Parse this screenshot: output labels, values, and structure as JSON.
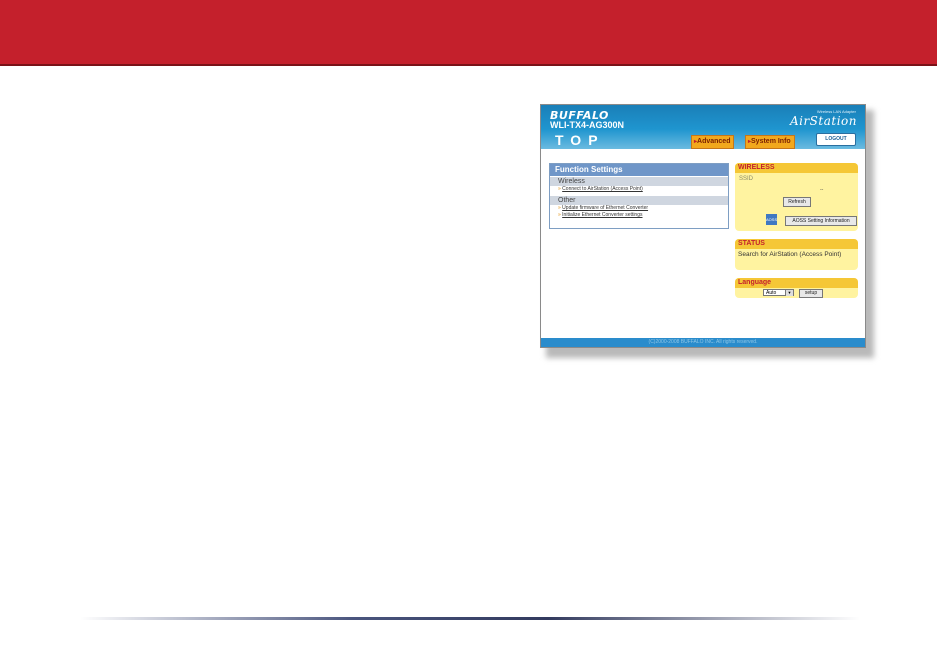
{
  "colors": {
    "banner": "#c4202c",
    "header_blue": "#1f95cf",
    "tab_orange": "#f2a81d",
    "box_yellow": "#fff3a0",
    "section_blue": "#6f96c8"
  },
  "header": {
    "brand": "BUFFALO",
    "model": "WLI-TX4-AG300N",
    "tagline": "Wireless LAN Adapter",
    "product_logo": "AirStation",
    "page_label": "TOP",
    "tab_advanced": "Advanced",
    "tab_system_info": "System Info",
    "logout": "LOGOUT"
  },
  "function_settings": {
    "title": "Function Settings",
    "wireless_header": "Wireless",
    "wireless_links": [
      "Connect to AirStation (Access Point)"
    ],
    "other_header": "Other",
    "other_links": [
      "Update firmware of Ethernet Converter",
      "Initialize Ethernet Converter settings"
    ]
  },
  "wireless": {
    "title": "WIRELESS",
    "ssid_label": "SSID",
    "ssid_value": "--",
    "refresh_button": "Refresh",
    "aoss_icon": "aoss-icon",
    "aoss_button": "AOSS Setting Information"
  },
  "status": {
    "title": "STATUS",
    "text": "Search for AirStation (Access Point)"
  },
  "language": {
    "title": "Language",
    "selected": "Auto",
    "setup_button": "setup"
  },
  "footer": "(C)2000-2008 BUFFALO INC. All rights reserved."
}
